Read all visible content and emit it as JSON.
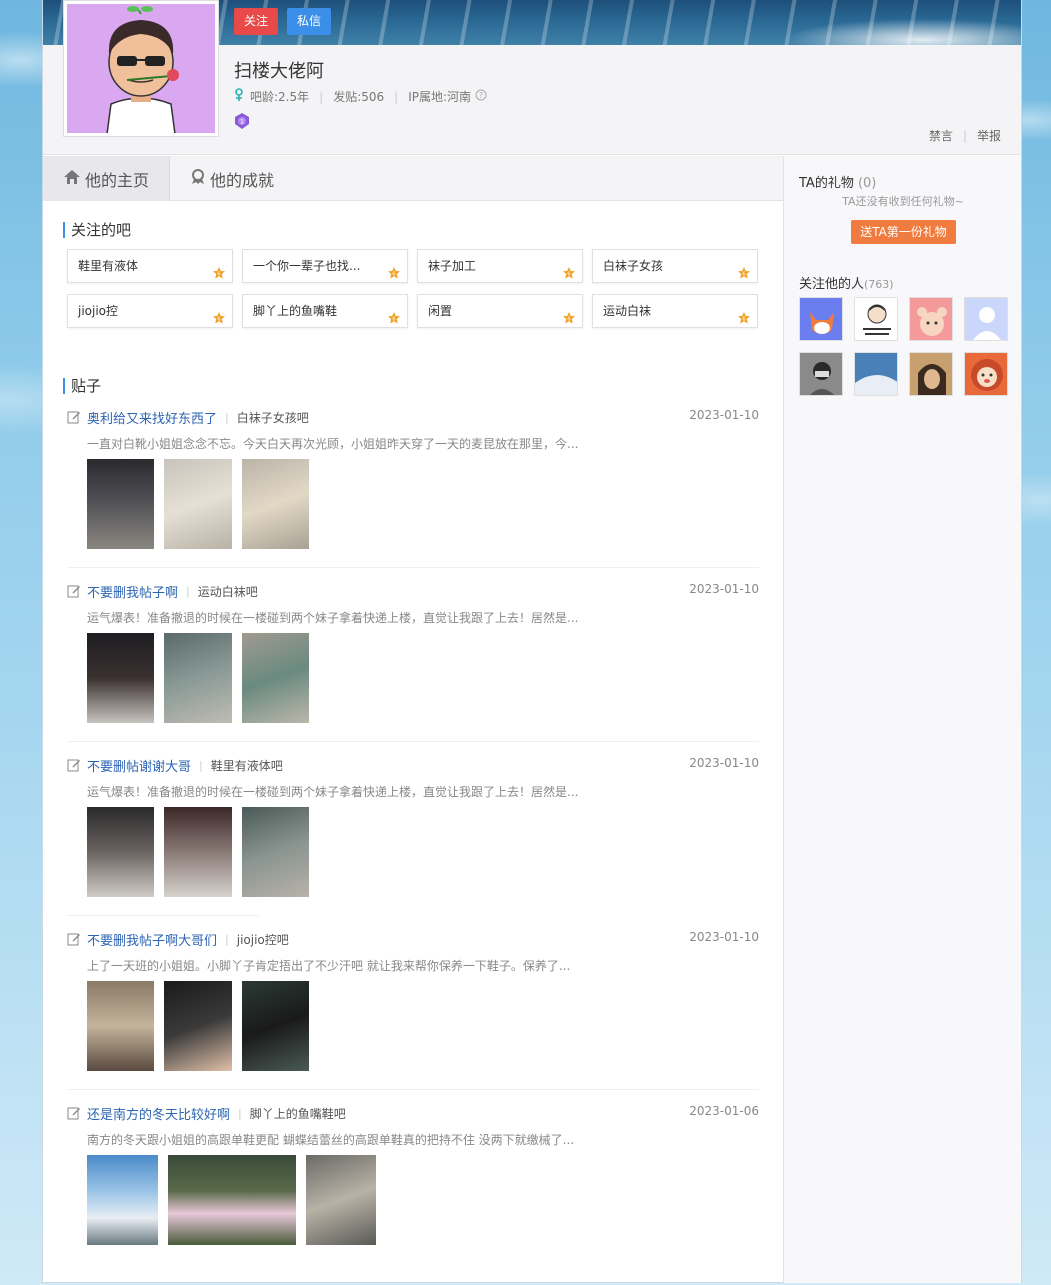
{
  "header": {
    "follow_label": "关注",
    "message_label": "私信",
    "username": "扫楼大佬阿",
    "age": "吧龄:2.5年",
    "posts": "发贴:506",
    "ip": "IP属地:河南",
    "ban_label": "禁言",
    "report_label": "举报"
  },
  "tabs": [
    {
      "label": "他的主页",
      "icon": "home-icon"
    },
    {
      "label": "他的成就",
      "icon": "achievement-icon"
    }
  ],
  "followed_bars": {
    "title": "关注的吧",
    "items": [
      {
        "name": "鞋里有液体"
      },
      {
        "name": "一个你一辈子也找..."
      },
      {
        "name": "袜子加工"
      },
      {
        "name": "白袜子女孩"
      },
      {
        "name": "jiojio控"
      },
      {
        "name": "脚丫上的鱼嘴鞋"
      },
      {
        "name": "闲置"
      },
      {
        "name": "运动白袜"
      }
    ]
  },
  "posts": {
    "title": "贴子",
    "items": [
      {
        "title": "奥利给又来找好东西了",
        "bar": "白袜子女孩吧",
        "date": "2023-01-10",
        "excerpt": "一直对白靴小姐姐念念不忘。今天白天再次光顾，小姐姐昨天穿了一天的麦昆放在那里，今..."
      },
      {
        "title": "不要删我帖子啊",
        "bar": "运动白袜吧",
        "date": "2023-01-10",
        "excerpt": "运气爆表！准备撤退的时候在一楼碰到两个妹子拿着快递上楼，直觉让我跟了上去！居然是..."
      },
      {
        "title": "不要删帖谢谢大哥",
        "bar": "鞋里有液体吧",
        "date": "2023-01-10",
        "excerpt": "运气爆表！准备撤退的时候在一楼碰到两个妹子拿着快递上楼，直觉让我跟了上去！居然是..."
      },
      {
        "title": "不要删我帖子啊大哥们",
        "bar": "jiojio控吧",
        "date": "2023-01-10",
        "excerpt": "上了一天班的小姐姐。小脚丫子肯定捂出了不少汗吧 就让我来帮你保养一下鞋子。保养了..."
      },
      {
        "title": "还是南方的冬天比较好啊",
        "bar": "脚丫上的鱼嘴鞋吧",
        "date": "2023-01-06",
        "excerpt": "南方的冬天跟小姐姐的高跟单鞋更配 蝴蝶结蕾丝的高跟单鞋真的把持不住 没两下就缴械了..."
      }
    ]
  },
  "sidebar": {
    "gift_title": "TA的礼物",
    "gift_count": "(0)",
    "gift_none": "TA还没有收到任何礼物~",
    "gift_button": "送TA第一份礼物",
    "fans_title": "关注他的人",
    "fans_count": "(763)"
  },
  "colors": {
    "accent_blue": "#3b8fe8",
    "follow_red": "#e84a4a",
    "gift_orange": "#f07b3f",
    "link_blue": "#2d64b3"
  }
}
